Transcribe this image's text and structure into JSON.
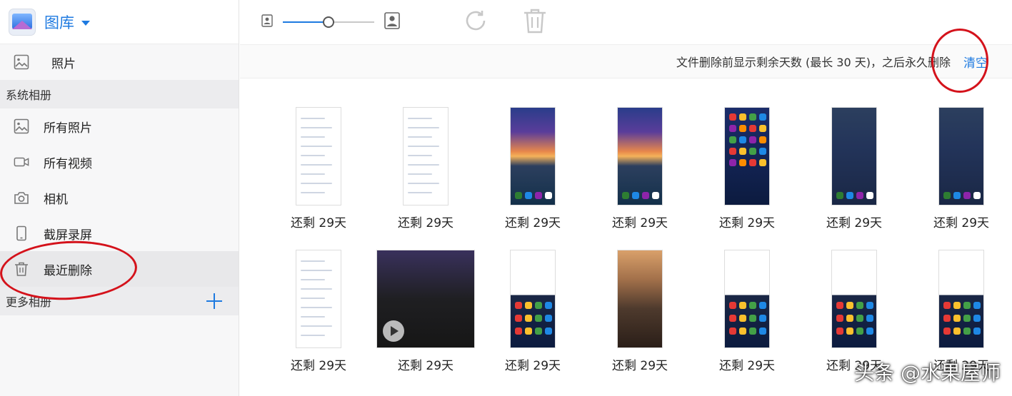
{
  "app": {
    "title": "图库"
  },
  "sidebar": {
    "photos": {
      "label": "照片"
    },
    "system_section": "系统相册",
    "items": [
      {
        "label": "所有照片",
        "icon": "image-icon"
      },
      {
        "label": "所有视频",
        "icon": "video-icon"
      },
      {
        "label": "相机",
        "icon": "camera-icon"
      },
      {
        "label": "截屏录屏",
        "icon": "phone-icon"
      },
      {
        "label": "最近删除",
        "icon": "trash-icon",
        "selected": true
      }
    ],
    "more_section": "更多相册"
  },
  "toolbar": {
    "zoom_value": 0.5
  },
  "info": {
    "message": "文件删除前显示剩余天数 (最长 30 天)，之后永久删除",
    "clear_label": "清空"
  },
  "grid": {
    "rows": [
      [
        {
          "type": "settings-screenshot",
          "caption": "还剩 29天"
        },
        {
          "type": "settings-screenshot",
          "caption": "还剩 29天"
        },
        {
          "type": "lockscreen-sunset",
          "caption": "还剩 29天"
        },
        {
          "type": "lockscreen-sunset",
          "caption": "还剩 29天"
        },
        {
          "type": "homescreen",
          "caption": "还剩 29天"
        },
        {
          "type": "lockscreen-dark",
          "caption": "还剩 29天"
        },
        {
          "type": "lockscreen-dark",
          "caption": "还剩 29天"
        }
      ],
      [
        {
          "type": "settings-screenshot",
          "caption": "还剩 29天"
        },
        {
          "type": "video",
          "caption": "还剩 29天"
        },
        {
          "type": "quick-settings",
          "caption": "还剩 29天"
        },
        {
          "type": "lockscreen-rocks",
          "caption": "还剩 29天"
        },
        {
          "type": "quick-settings",
          "caption": "还剩 29天"
        },
        {
          "type": "quick-settings",
          "caption": "还剩 29天"
        },
        {
          "type": "quick-settings",
          "caption": "还剩 29天"
        }
      ]
    ]
  },
  "watermark": "头条 @水果屋师",
  "colors": {
    "accent": "#1e7ae0",
    "annotation": "#d4121b"
  }
}
